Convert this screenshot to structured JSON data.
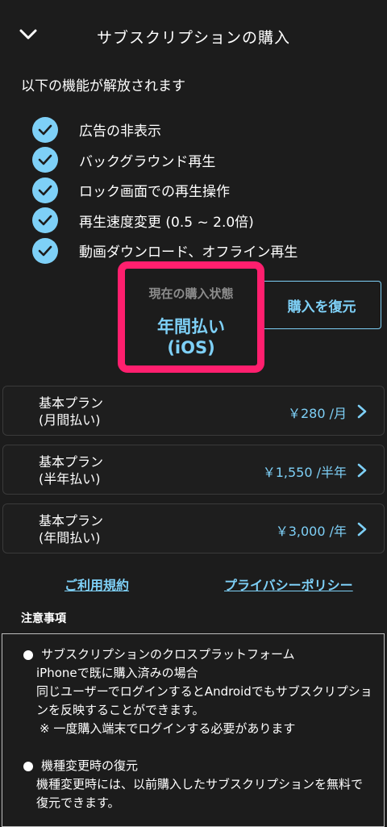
{
  "header": {
    "title": "サブスクリプションの購入"
  },
  "intro": "以下の機能が解放されます",
  "features": [
    "広告の非表示",
    "バックグラウンド再生",
    "ロック画面での再生操作",
    "再生速度変更 (0.5 ~ 2.0倍)",
    "動画ダウンロード、オフライン再生"
  ],
  "status": {
    "caption": "現在の購入状態",
    "value": "年間払い\n(iOS)",
    "restore_label": "購入を復元"
  },
  "plans": [
    {
      "name": "基本プラン\n(月間払い)",
      "price": "￥280 /月"
    },
    {
      "name": "基本プラン\n(半年払い)",
      "price": "￥1,550 /半年"
    },
    {
      "name": "基本プラン\n(年間払い)",
      "price": "￥3,000 /年"
    }
  ],
  "links": {
    "terms": "ご利用規約",
    "privacy": "プライバシーポリシー"
  },
  "notes": {
    "title": "注意事項",
    "items": [
      {
        "heading": "サブスクリプションのクロスプラットフォーム",
        "body": "iPhoneで既に購入済みの場合\n同じユーザーでログインするとAndroidでもサブスクリプションを反映することができます。",
        "sub": "※ 一度購入端末でログインする必要があります"
      },
      {
        "heading": "機種変更時の復元",
        "body": "機種変更時には、以前購入したサブスクリプションを無料で復元できます。",
        "sub": ""
      }
    ]
  },
  "colors": {
    "accent": "#7ed0f7",
    "highlight": "#ff1f6e",
    "background": "#1c1c1c"
  },
  "icons": {
    "back": "chevron-down-icon",
    "check": "check-circle-icon",
    "arrow": "chevron-right-icon"
  }
}
